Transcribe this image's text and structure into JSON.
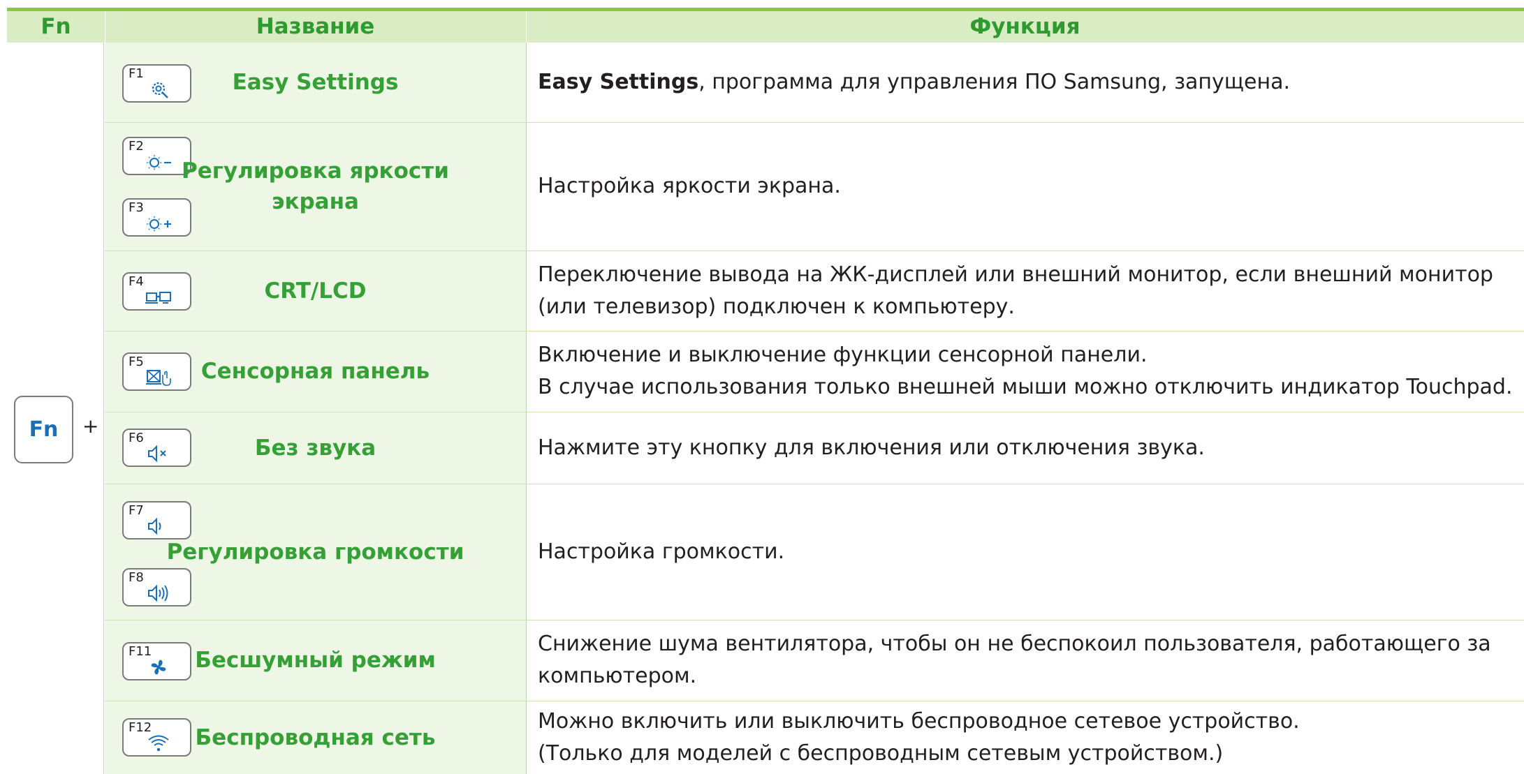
{
  "header": {
    "fn": "Fn",
    "name": "Название",
    "function": "Функция"
  },
  "fn_key": {
    "label": "Fn",
    "plus": "+"
  },
  "colors": {
    "accent": "#2f9a2f",
    "header_bg": "#d9ecc4",
    "name_bg": "#eef6e6",
    "icon_blue": "#1a6fb8"
  },
  "rows": [
    {
      "keys": [
        {
          "label": "F1",
          "icon": "settings-gear-icon"
        }
      ],
      "name": "Easy Settings",
      "function_bold": "Easy Settings",
      "function_rest": ", программа для управления ПО Samsung, запущена."
    },
    {
      "keys": [
        {
          "label": "F2",
          "icon": "brightness-down-icon"
        },
        {
          "label": "F3",
          "icon": "brightness-up-icon"
        }
      ],
      "name_line1": "Регулировка яркости",
      "name_line2": "экрана",
      "function": "Настройка яркости экрана."
    },
    {
      "keys": [
        {
          "label": "F4",
          "icon": "crt-lcd-icon"
        }
      ],
      "name": "CRT/LCD",
      "function_line1": "Переключение вывода на ЖК-дисплей или внешний монитор, если внешний монитор",
      "function_line2": "(или телевизор) подключен к компьютеру."
    },
    {
      "keys": [
        {
          "label": "F5",
          "icon": "touchpad-icon"
        }
      ],
      "name": "Сенсорная панель",
      "function_line1": "Включение и выключение функции сенсорной панели.",
      "function_line2": "В случае использования только внешней мыши можно отключить индикатор Touchpad."
    },
    {
      "keys": [
        {
          "label": "F6",
          "icon": "mute-icon"
        }
      ],
      "name": "Без звука",
      "function": "Нажмите эту кнопку для включения или отключения звука."
    },
    {
      "keys": [
        {
          "label": "F7",
          "icon": "volume-down-icon"
        },
        {
          "label": "F8",
          "icon": "volume-up-icon"
        }
      ],
      "name": "Регулировка громкости",
      "function": "Настройка громкости."
    },
    {
      "keys": [
        {
          "label": "F11",
          "icon": "fan-icon"
        }
      ],
      "name": "Бесшумный режим",
      "function_line1": "Снижение шума вентилятора, чтобы он не беспокоил пользователя, работающего за",
      "function_line2": "компьютером."
    },
    {
      "keys": [
        {
          "label": "F12",
          "icon": "wifi-icon"
        }
      ],
      "name": "Беспроводная сеть",
      "function_line1": "Можно включить или выключить беспроводное сетевое устройство.",
      "function_line2": "(Только для моделей с беспроводным сетевым устройством.)"
    }
  ]
}
